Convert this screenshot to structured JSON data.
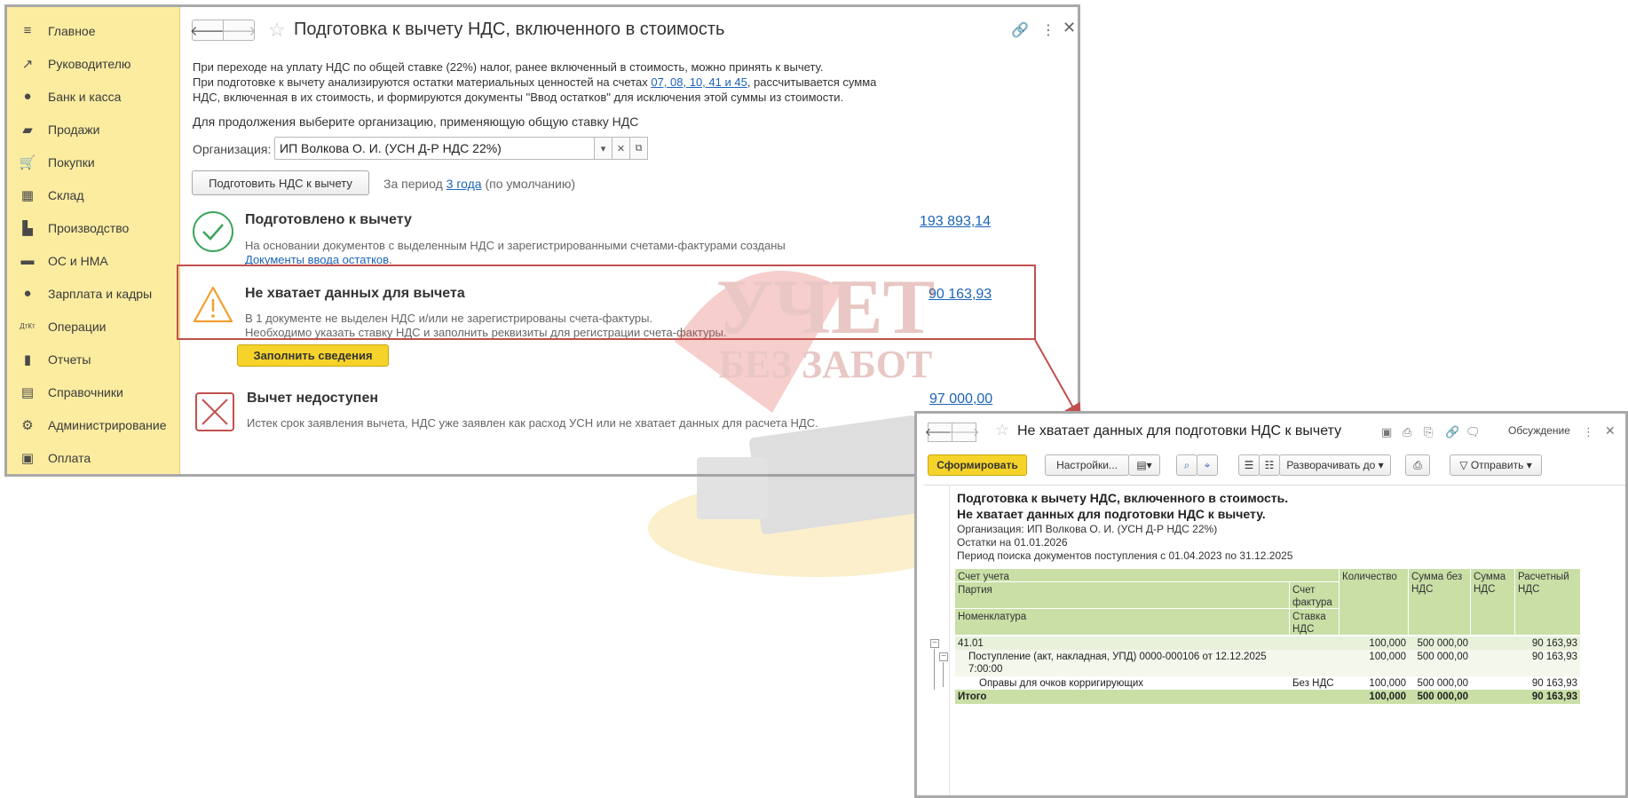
{
  "sidebar": {
    "items": [
      {
        "label": "Главное",
        "icon": "menu-icon",
        "glyph": "≡"
      },
      {
        "label": "Руководителю",
        "icon": "trend-icon",
        "glyph": "↗"
      },
      {
        "label": "Банк и касса",
        "icon": "coin-icon",
        "glyph": "●"
      },
      {
        "label": "Продажи",
        "icon": "bag-icon",
        "glyph": "▰"
      },
      {
        "label": "Покупки",
        "icon": "cart-icon",
        "glyph": "🛒"
      },
      {
        "label": "Склад",
        "icon": "warehouse-icon",
        "glyph": "▦"
      },
      {
        "label": "Производство",
        "icon": "factory-icon",
        "glyph": "▙"
      },
      {
        "label": "ОС и НМА",
        "icon": "truck-icon",
        "glyph": "▬"
      },
      {
        "label": "Зарплата и кадры",
        "icon": "person-icon",
        "glyph": "●"
      },
      {
        "label": "Операции",
        "icon": "dt-kt-icon",
        "glyph": "ДтКт"
      },
      {
        "label": "Отчеты",
        "icon": "bar-chart-icon",
        "glyph": "▮"
      },
      {
        "label": "Справочники",
        "icon": "books-icon",
        "glyph": "▤"
      },
      {
        "label": "Администрирование",
        "icon": "gear-icon",
        "glyph": "⚙"
      },
      {
        "label": "Оплата",
        "icon": "wallet-icon",
        "glyph": "▣"
      }
    ]
  },
  "main": {
    "title": "Подготовка к вычету НДС, включенного в стоимость",
    "desc_line1": "При переходе на уплату НДС по общей ставке (22%) налог, ранее включенный в стоимость, можно принять к вычету.",
    "desc_line2_pre": "При подготовке к вычету анализируются остатки материальных ценностей на счетах ",
    "desc_accounts": "07, 08, 10, 41 и 45",
    "desc_line2_post": ", рассчитывается сумма",
    "desc_line3": "НДС, включенная в их стоимость, и формируются документы \"Ввод остатков\" для исключения этой суммы из стоимости.",
    "hint": "Для продолжения выберите организацию, применяющую общую ставку НДС",
    "org_label": "Организация:",
    "org_value": "ИП Волкова О. И. (УСН Д-Р НДС 22%)",
    "prepare_button": "Подготовить НДС к вычету",
    "period_pre": "За период ",
    "period_link": "3 года",
    "period_post": " (по умолчанию)",
    "sections": {
      "ready": {
        "title": "Подготовлено к вычету",
        "text": "На основании документов с выделенным НДС и зарегистрированными счетами-фактурами созданы",
        "link": "Документы ввода остатков",
        "amount": "193 893,14"
      },
      "missing": {
        "title": "Не хватает данных для вычета",
        "text1": "В 1 документе не выделен НДС и/или не зарегистрированы счета-фактуры.",
        "text2": "Необходимо указать ставку НДС и заполнить реквизиты для регистрации счета-фактуры.",
        "amount": "90 163,93",
        "button": "Заполнить сведения"
      },
      "unavailable": {
        "title": "Вычет недоступен",
        "text": "Истек срок заявления вычета, НДС уже заявлен как расход УСН или не хватает данных для расчета НДС.",
        "amount": "97 000,00"
      }
    },
    "colors": {
      "highlight": "#c0504d",
      "ok": "#3aa55a",
      "warn": "#f0a030",
      "error": "#c0504d",
      "link": "#1c64b8",
      "sidebar": "#fbeca0"
    }
  },
  "watermark": {
    "line1": "УЧЕТ",
    "line2": "БЕЗ ЗАБОТ"
  },
  "report": {
    "title": "Не хватает данных для подготовки НДС к вычету",
    "discuss": "Обсуждение",
    "toolbar": {
      "generate": "Сформировать",
      "settings": "Настройки...",
      "expand": "Разворачивать до",
      "send": "Отправить"
    },
    "heading1": "Подготовка к вычету НДС, включенного в стоимость.",
    "heading2": "Не хватает данных для подготовки НДС к вычету.",
    "org_line": "Организация: ИП Волкова О. И. (УСН Д-Р НДС 22%)",
    "balance_line": "Остатки на 01.01.2026",
    "period_line": "Период поиска документов поступления с 01.04.2023 по 31.12.2025",
    "table": {
      "headers": {
        "account": "Счет учета",
        "batch": "Партия",
        "invoice": "Счет фактура",
        "item": "Номенклатура",
        "rate": "Ставка НДС",
        "qty": "Количество",
        "sum": "Сумма без НДС",
        "vat_sum": "Сумма НДС",
        "calc_vat": "Расчетный НДС"
      },
      "rows": [
        {
          "level": 0,
          "name": "41.01",
          "rate": "",
          "qty": "100,000",
          "sum": "500 000,00",
          "vat": "",
          "calc": "90 163,93"
        },
        {
          "level": 1,
          "name": "Поступление (акт, накладная, УПД) 0000-000106 от 12.12.2025",
          "name2": "7:00:00",
          "rate": "",
          "qty": "100,000",
          "sum": "500 000,00",
          "vat": "",
          "calc": "90 163,93"
        },
        {
          "level": 2,
          "name": "Оправы для очков корригирующих",
          "rate": "Без НДС",
          "qty": "100,000",
          "sum": "500 000,00",
          "vat": "",
          "calc": "90 163,93"
        }
      ],
      "total": {
        "name": "Итого",
        "qty": "100,000",
        "sum": "500 000,00",
        "vat": "",
        "calc": "90 163,93"
      }
    }
  }
}
